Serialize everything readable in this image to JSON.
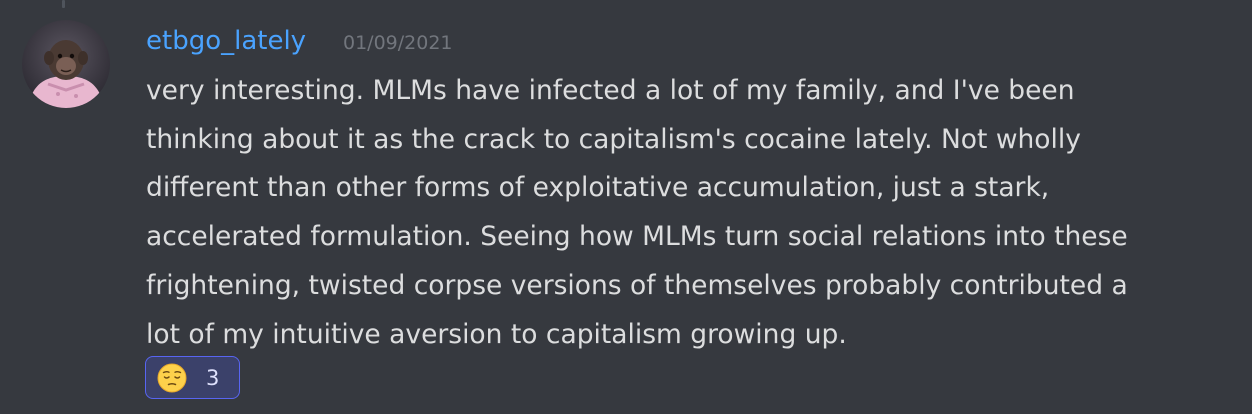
{
  "message": {
    "username": "etbgo_lately",
    "timestamp": "01/09/2021",
    "lines": [
      "very interesting. MLMs have infected a lot of my family, and I've been",
      "thinking about it as the crack to capitalism's cocaine lately. Not wholly",
      "different than other forms of exploitative accumulation, just a stark,",
      "accelerated formulation. Seeing how MLMs turn social relations into these",
      "frightening, twisted corpse versions of themselves probably contributed a",
      "lot of my intuitive aversion to capitalism growing up."
    ],
    "reactions": [
      {
        "emoji_icon": "pensive-face-icon",
        "count": "3"
      }
    ]
  },
  "colors": {
    "background": "#36393f",
    "username": "#4aa3ff",
    "timestamp": "#72767d",
    "text": "#dcddde",
    "reaction_bg": "#3b416a",
    "reaction_border": "#5865f2"
  }
}
